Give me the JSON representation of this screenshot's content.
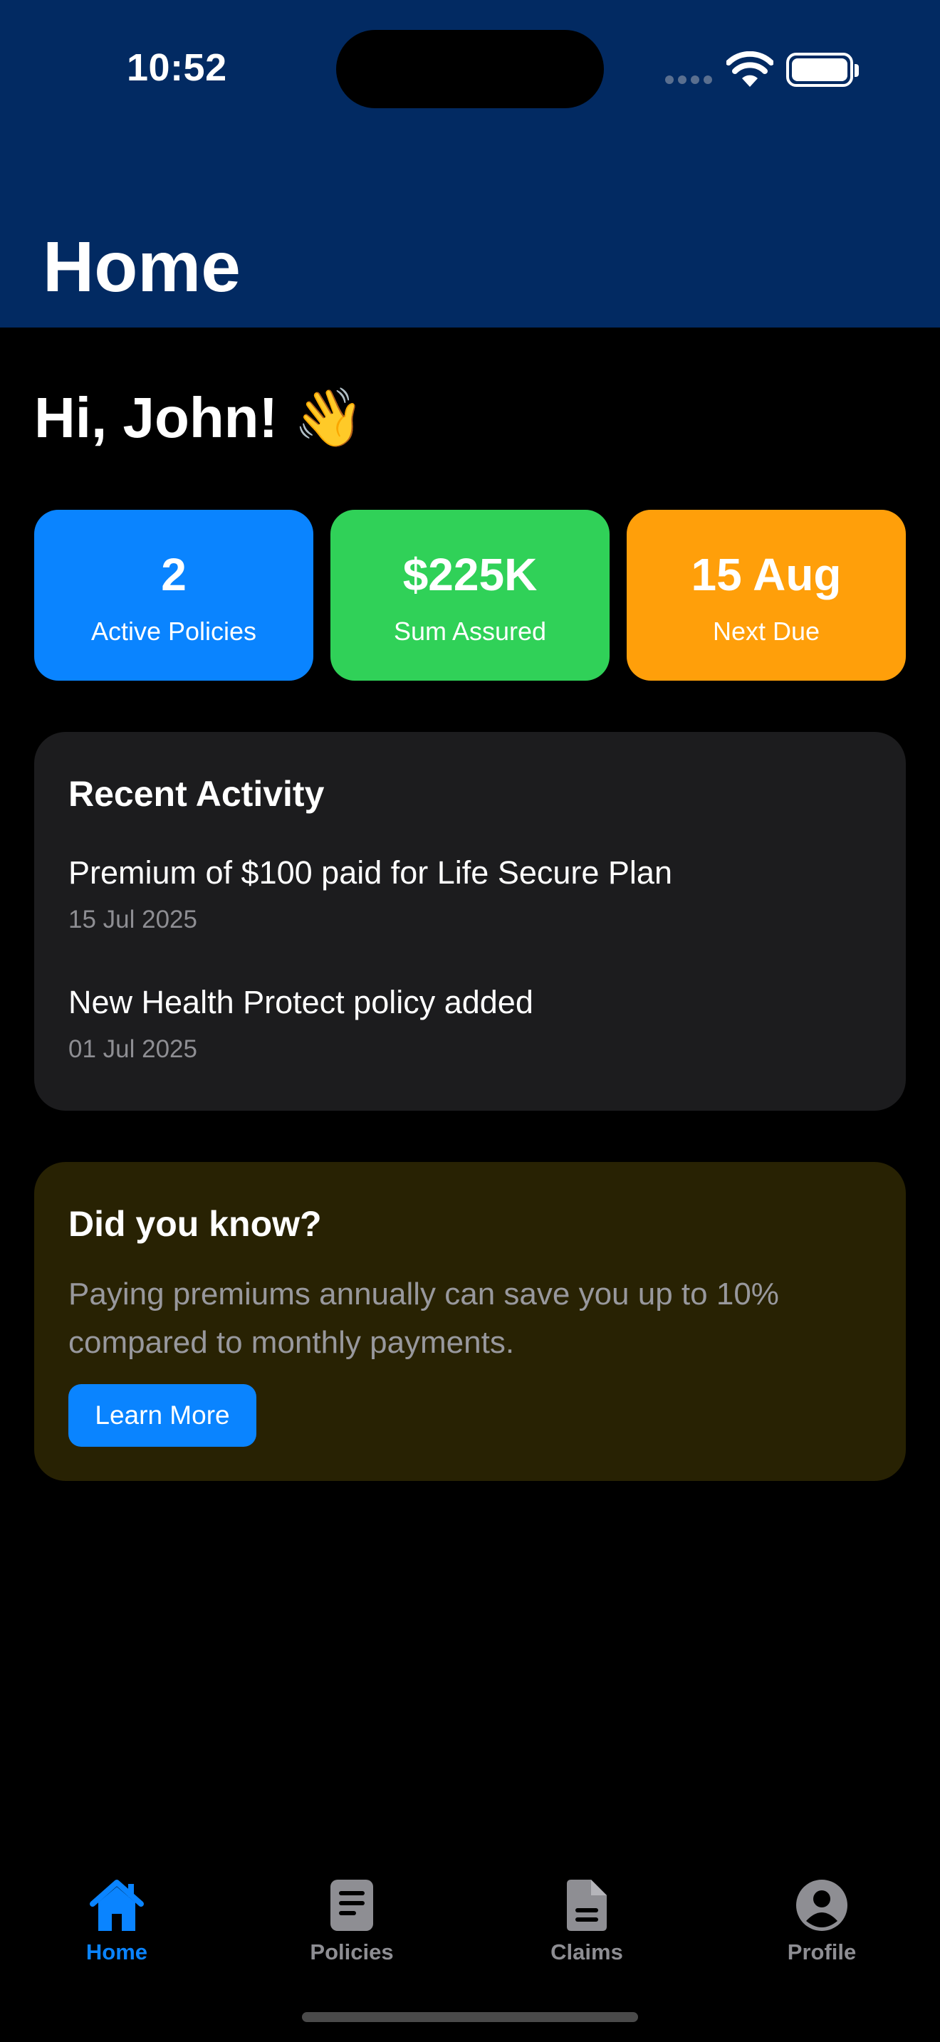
{
  "status_bar": {
    "time": "10:52"
  },
  "header": {
    "title": "Home"
  },
  "greeting": {
    "text": "Hi, John! 👋"
  },
  "stats": [
    {
      "value": "2",
      "label": "Active Policies",
      "color": "#0a84ff"
    },
    {
      "value": "$225K",
      "label": "Sum Assured",
      "color": "#30d158"
    },
    {
      "value": "15 Aug",
      "label": "Next Due",
      "color": "#ff9f0a"
    }
  ],
  "recent_activity": {
    "heading": "Recent Activity",
    "items": [
      {
        "title": "Premium of $100 paid for Life Secure Plan",
        "date": "15 Jul 2025"
      },
      {
        "title": "New Health Protect policy added",
        "date": "01 Jul 2025"
      }
    ]
  },
  "tip": {
    "heading": "Did you know?",
    "text": "Paying premiums annually can save you up to 10% compared to monthly payments.",
    "button_label": "Learn More"
  },
  "tab_bar": {
    "active": "Home",
    "accent": "#0a84ff",
    "items": [
      {
        "label": "Home",
        "icon": "house-icon"
      },
      {
        "label": "Policies",
        "icon": "document-icon"
      },
      {
        "label": "Claims",
        "icon": "file-icon"
      },
      {
        "label": "Profile",
        "icon": "person-circle-icon"
      }
    ]
  }
}
